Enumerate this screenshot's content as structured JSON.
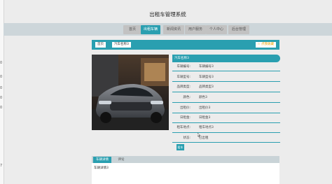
{
  "app": {
    "title": "出租车管理系统"
  },
  "left_edge": {
    "marks": [
      "0",
      "0",
      "0",
      "0",
      "0",
      "7"
    ]
  },
  "nav": {
    "items": [
      {
        "label": "首页",
        "active": false
      },
      {
        "label": "出租车辆",
        "active": true
      },
      {
        "label": "新闻资讯",
        "active": false
      },
      {
        "label": "用户服务",
        "active": false
      },
      {
        "label": "个人中心",
        "active": false
      },
      {
        "label": "后台管理",
        "active": false
      }
    ]
  },
  "breadcrumb": {
    "home": "首页",
    "current": "汽车名称3"
  },
  "favorite": {
    "label": "☆ 点我收藏"
  },
  "details": {
    "title": "汽车名称3",
    "rows": [
      {
        "label": "车辆编号:",
        "value": "车辆编号3"
      },
      {
        "label": "车辆型号:",
        "value": "车辆型号3"
      },
      {
        "label": "品牌类型:",
        "value": "品牌类型3"
      },
      {
        "label": "颜色:",
        "value": "颜色3"
      },
      {
        "label": "出租价:",
        "value": "出租价3"
      },
      {
        "label": "日租金:",
        "value": "日租金3"
      },
      {
        "label": "租车地点:",
        "value": "租车地点3"
      },
      {
        "label": "状态:",
        "value": "已出租"
      }
    ],
    "submit_label": "租车"
  },
  "tabs": {
    "items": [
      "车辆详情",
      "评论"
    ],
    "content": "车辆详情3"
  },
  "colors": {
    "accent": "#2a9fb0",
    "favorite": "#e7a300",
    "nav_bg": "#cdd6da"
  }
}
